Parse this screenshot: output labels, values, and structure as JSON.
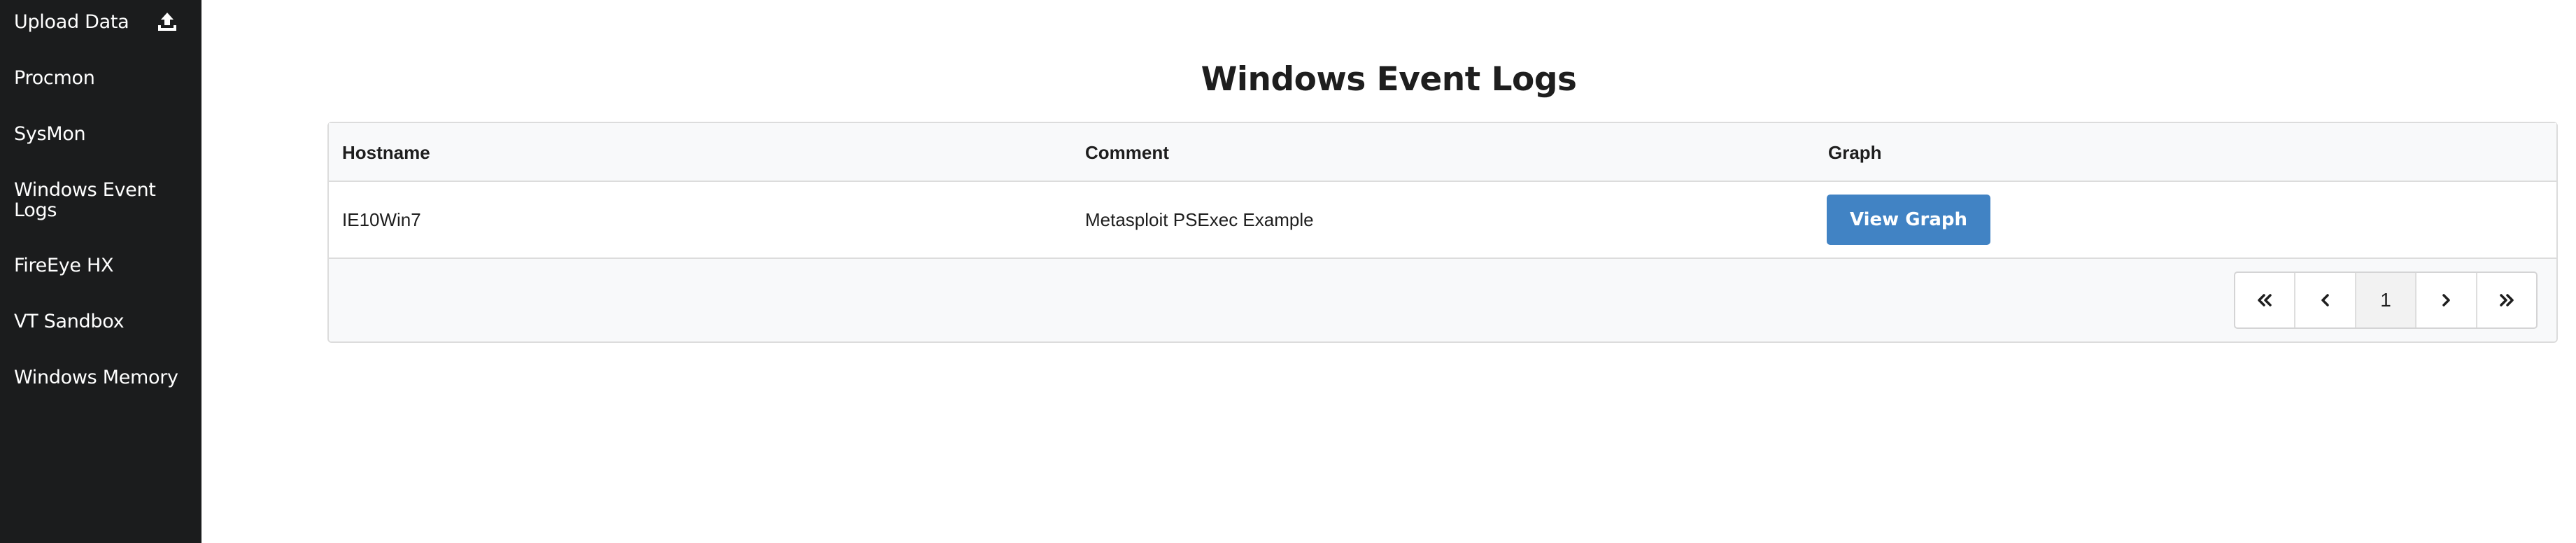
{
  "sidebar": {
    "items": [
      {
        "label": "Upload Data",
        "icon": "upload-icon"
      },
      {
        "label": "Procmon"
      },
      {
        "label": "SysMon"
      },
      {
        "label": "Windows Event Logs"
      },
      {
        "label": "FireEye HX"
      },
      {
        "label": "VT Sandbox"
      },
      {
        "label": "Windows Memory"
      }
    ]
  },
  "main": {
    "title": "Windows Event Logs",
    "table": {
      "columns": [
        "Hostname",
        "Comment",
        "Graph"
      ],
      "rows": [
        {
          "hostname": "IE10Win7",
          "comment": "Metasploit PSExec Example",
          "action": "View Graph"
        }
      ]
    },
    "pagination": {
      "current_page": "1",
      "icons": [
        "double-chevron-left-icon",
        "chevron-left-icon",
        "chevron-right-icon",
        "double-chevron-right-icon"
      ]
    }
  },
  "colors": {
    "sidebar_bg": "#1b1c1d",
    "button_bg": "#4183c4",
    "header_bg": "#f8f9fa"
  }
}
